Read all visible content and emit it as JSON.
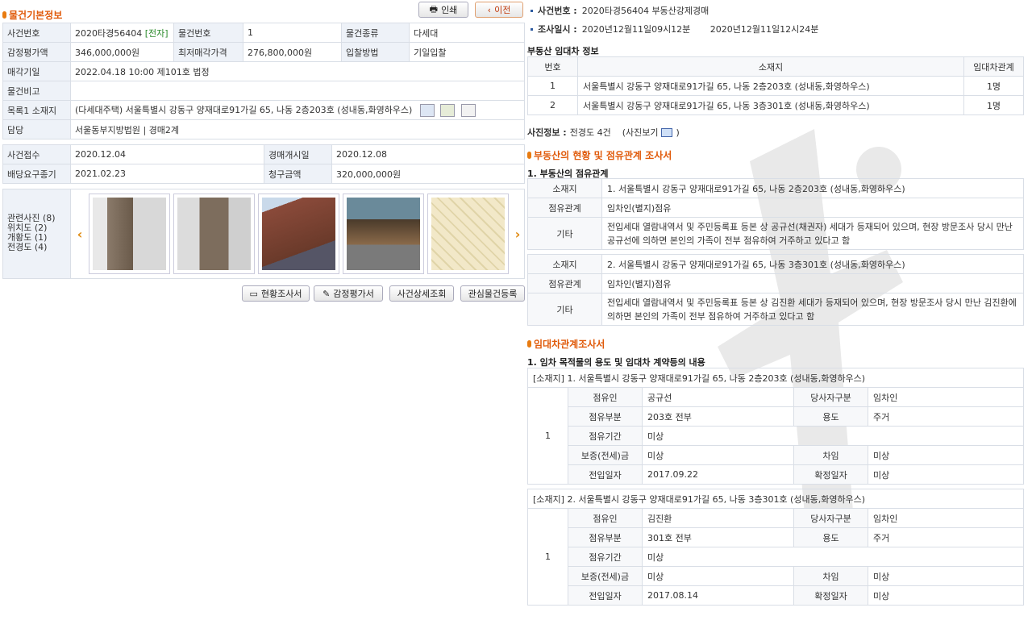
{
  "left": {
    "section_title": "물건기본정보",
    "print_label": "인쇄",
    "prev_label": "이전",
    "basic_rows": [
      {
        "l1": "사건번호",
        "v1": "2020타경56404",
        "tag": "[전자]",
        "l2": "물건번호",
        "v2": "1",
        "l3": "물건종류",
        "v3": "다세대"
      },
      {
        "l1": "감정평가액",
        "v1": "346,000,000원",
        "l2": "최저매각가격",
        "v2": "276,800,000원",
        "l3": "입찰방법",
        "v3": "기일입찰"
      }
    ],
    "sale_date_label": "매각기일",
    "sale_date_value": "2022.04.18 10:00 제101호 법정",
    "note_label": "물건비고",
    "note_value": "",
    "address_label": "목록1 소재지",
    "address_value": "(다세대주택) 서울특별시 강동구 양재대로91가길 65, 나동 2층203호 (성내동,화영하우스)",
    "court_label": "담당",
    "court_value": "서울동부지방법원 | 경매2계",
    "dates": [
      {
        "l1": "사건접수",
        "v1": "2020.12.04",
        "l2": "경매개시일",
        "v2": "2020.12.08"
      },
      {
        "l1": "배당요구종기",
        "v1": "2021.02.23",
        "l2": "청구금액",
        "v2": "320,000,000원"
      }
    ],
    "photo_labels": [
      "관련사진 (8)",
      "위치도 (2)",
      "개황도 (1)",
      "전경도 (4)"
    ],
    "bottom_buttons": [
      "현황조사서",
      "감정평가서",
      "사건상세조회",
      "관심물건등록"
    ]
  },
  "right": {
    "case_label": "사건번호 :",
    "case_value": "2020타경56404 부동산강제경매",
    "survey_label": "조사일시 :",
    "survey_value": "2020년12월11일09시12분       2020년12월11일12시24분",
    "lease_info_title": "부동산 임대차 정보",
    "lease_cols": [
      "번호",
      "소재지",
      "임대차관계"
    ],
    "lease_rows": [
      {
        "no": "1",
        "addr": "서울특별시 강동구 양재대로91가길 65, 나동 2층203호 (성내동,화영하우스)",
        "rel": "1명"
      },
      {
        "no": "2",
        "addr": "서울특별시 강동구 양재대로91가길 65, 나동 3층301호 (성내동,화영하우스)",
        "rel": "1명"
      }
    ],
    "photo_info_label": "사진정보 :",
    "photo_info_value": "전경도 4건",
    "photo_view": "(사진보기",
    "status_title": "부동산의 현황 및 점유관계 조사서",
    "occupy_title": "1. 부동산의 점유관계",
    "occupy_blocks": [
      {
        "l_addr": "소재지",
        "addr": "1. 서울특별시 강동구 양재대로91가길 65, 나동 2층203호 (성내동,화영하우스)",
        "l_rel": "점유관계",
        "rel": "임차인(별지)점유",
        "l_etc": "기타",
        "etc": "전입세대 열람내역서 및 주민등록표 등본 상 공규선(채권자) 세대가 등재되어 있으며, 현장 방문조사 당시 만난 공규선에 의하면 본인의 가족이 전부 점유하여 거주하고 있다고 함"
      },
      {
        "l_addr": "소재지",
        "addr": "2. 서울특별시 강동구 양재대로91가길 65, 나동 3층301호 (성내동,화영하우스)",
        "l_rel": "점유관계",
        "rel": "임차인(별지)점유",
        "l_etc": "기타",
        "etc": "전입세대 열람내역서 및 주민등록표 등본 상 김진환 세대가 등재되어 있으며, 현장 방문조사 당시 만난 김진환에 의하면 본인의 가족이 전부 점유하여 거주하고 있다고 함"
      }
    ],
    "lease_survey_title": "임대차관계조사서",
    "lease_use_title": "1. 임차 목적물의 용도 및 임대차 계약등의 내용",
    "tenants": [
      {
        "header": "[소재지] 1. 서울특별시 강동구 양재대로91가길 65, 나동 2층203호 (성내동,화영하우스)",
        "no": "1",
        "occupant_l": "점유인",
        "occupant": "공규선",
        "party_l": "당사자구분",
        "party": "임차인",
        "part_l": "점유부분",
        "part": "203호 전부",
        "use_l": "용도",
        "use": "주거",
        "period_l": "점유기간",
        "period": "미상",
        "deposit_l": "보증(전세)금",
        "deposit": "미상",
        "rent_l": "차임",
        "rent": "미상",
        "move_l": "전입일자",
        "move": "2017.09.22",
        "fix_l": "확정일자",
        "fix": "미상"
      },
      {
        "header": "[소재지] 2. 서울특별시 강동구 양재대로91가길 65, 나동 3층301호 (성내동,화영하우스)",
        "no": "1",
        "occupant_l": "점유인",
        "occupant": "김진환",
        "party_l": "당사자구분",
        "party": "임차인",
        "part_l": "점유부분",
        "part": "301호 전부",
        "use_l": "용도",
        "use": "주거",
        "period_l": "점유기간",
        "period": "미상",
        "deposit_l": "보증(전세)금",
        "deposit": "미상",
        "rent_l": "차임",
        "rent": "미상",
        "move_l": "전입일자",
        "move": "2017.08.14",
        "fix_l": "확정일자",
        "fix": "미상"
      }
    ]
  },
  "colors": {
    "accent": "#e05a0a",
    "label_bg": "#eef2f8",
    "border": "#d9dee6"
  }
}
